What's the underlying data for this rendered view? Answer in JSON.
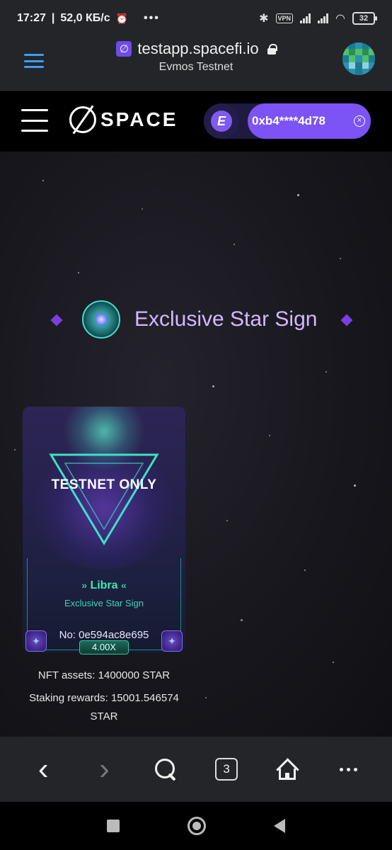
{
  "status_bar": {
    "time": "17:27",
    "net_speed": "52,0 КБ/с",
    "vpn_label": "VPN",
    "battery": "32"
  },
  "browser": {
    "url": "testapp.spacefi.io",
    "network": "Evmos Testnet",
    "site_icon_glyph": "∅"
  },
  "site_header": {
    "logo_text": "SPACE",
    "wallet_chain_glyph": "E",
    "wallet_address": "0xb4****4d78",
    "disconnect_glyph": "×"
  },
  "section": {
    "title": "Exclusive Star Sign"
  },
  "nft_card": {
    "overlay_text": "TESTNET ONLY",
    "name": "Libra",
    "chevrons_left": "»",
    "chevrons_right": "«",
    "subtitle": "Exclusive Star Sign",
    "number_label": "No: 0e594ac8e695",
    "multiplier": "4.00X",
    "corner_glyph": "✦"
  },
  "info": {
    "nft_assets": "NFT assets: 1400000 STAR",
    "staking_rewards_line1": "Staking rewards: 15001.546574",
    "staking_rewards_line2": "STAR"
  },
  "bottom_nav": {
    "back_glyph": "‹",
    "forward_glyph": "›",
    "tabs_count": "3"
  },
  "colors": {
    "accent_purple": "#7c53f4",
    "title_lavender": "#d2b9ff",
    "card_teal": "#3de8b0",
    "browser_blue": "#3d9df2"
  }
}
